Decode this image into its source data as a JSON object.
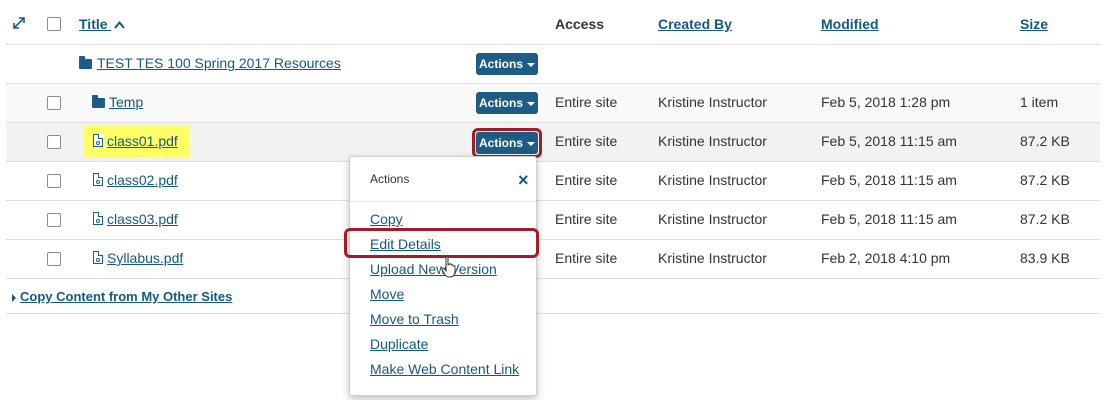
{
  "header": {
    "expand_icon_label": "⤢",
    "title": "Title",
    "sort_arrow": "^",
    "access": "Access",
    "created_by": "Created By",
    "modified": "Modified",
    "size": "Size"
  },
  "parent_folder": {
    "name": "TEST TES 100 Spring 2017 Resources",
    "actions_label": "Actions"
  },
  "rows": [
    {
      "name": "Temp",
      "type": "folder",
      "actions_label": "Actions",
      "access": "Entire site",
      "created_by": "Kristine Instructor",
      "modified": "Feb 5, 2018 1:28 pm",
      "size": "1 item"
    },
    {
      "name": "class01.pdf",
      "type": "pdf",
      "actions_label": "Actions",
      "access": "Entire site",
      "created_by": "Kristine Instructor",
      "modified": "Feb 5, 2018 11:15 am",
      "size": "87.2 KB"
    },
    {
      "name": "class02.pdf",
      "type": "pdf",
      "access": "Entire site",
      "created_by": "Kristine Instructor",
      "modified": "Feb 5, 2018 11:15 am",
      "size": "87.2 KB"
    },
    {
      "name": "class03.pdf",
      "type": "pdf",
      "access": "Entire site",
      "created_by": "Kristine Instructor",
      "modified": "Feb 5, 2018 11:15 am",
      "size": "87.2 KB"
    },
    {
      "name": "Syllabus.pdf",
      "type": "pdf",
      "access": "Entire site",
      "created_by": "Kristine Instructor",
      "modified": "Feb 2, 2018 4:10 pm",
      "size": "83.9 KB"
    }
  ],
  "footer": {
    "copy_content": "Copy Content from My Other Sites"
  },
  "actions_menu": {
    "title": "Actions",
    "close": "×",
    "items": [
      "Copy",
      "Edit Details",
      "Upload New Version",
      "Move",
      "Move to Trash",
      "Duplicate",
      "Make Web Content Link"
    ]
  },
  "colors": {
    "link": "#15597e",
    "button": "#1d5c85",
    "highlight": "#ffff66",
    "callout": "#a01c26"
  }
}
